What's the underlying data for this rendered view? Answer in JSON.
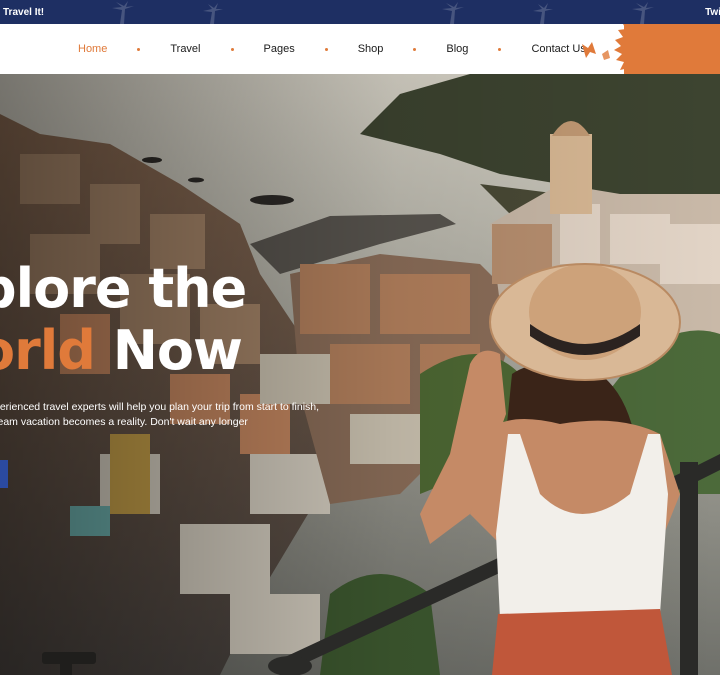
{
  "topbar": {
    "left_text": "Travel It!",
    "right_text": "Twi"
  },
  "nav": {
    "items": [
      {
        "label": "Home",
        "active": true
      },
      {
        "label": "Travel",
        "active": false
      },
      {
        "label": "Pages",
        "active": false
      },
      {
        "label": "Shop",
        "active": false
      },
      {
        "label": "Blog",
        "active": false
      },
      {
        "label": "Contact Us",
        "active": false
      }
    ]
  },
  "hero": {
    "title_line1": "plore the",
    "title_line2_accent": "orld",
    "title_line2_rest": " Now",
    "subtitle_line1": "perienced travel experts will help you plan your trip from start to finish,",
    "subtitle_line2": "ream vacation becomes a reality. Don't wait any longer"
  },
  "colors": {
    "accent": "#e07a3a",
    "topbar": "#1e2f63",
    "nav_bg": "#ffffff"
  }
}
